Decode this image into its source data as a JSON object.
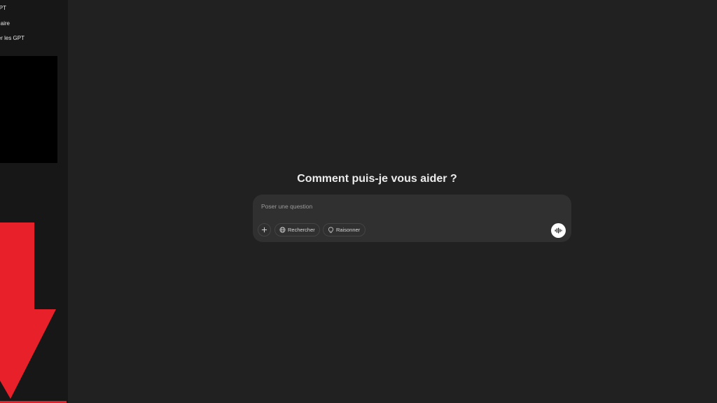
{
  "sidebar": {
    "items": [
      {
        "label": "PT",
        "icon": "chatgpt-icon"
      },
      {
        "label": "aire",
        "icon": "library-icon"
      },
      {
        "label": "er les GPT",
        "icon": "explore-gpts-icon"
      }
    ]
  },
  "main": {
    "heading": "Comment puis-je vous aider ?",
    "composer": {
      "placeholder": "Poser une question",
      "value": "",
      "add_icon": "plus-icon",
      "search_label": "Rechercher",
      "search_icon": "globe-icon",
      "reason_label": "Raisonner",
      "reason_icon": "lightbulb-icon",
      "voice_icon": "voice-waveform-icon"
    }
  },
  "colors": {
    "sidebar_bg": "#171717",
    "main_bg": "#212121",
    "composer_bg": "#303030",
    "arrow": "#e0202a"
  }
}
